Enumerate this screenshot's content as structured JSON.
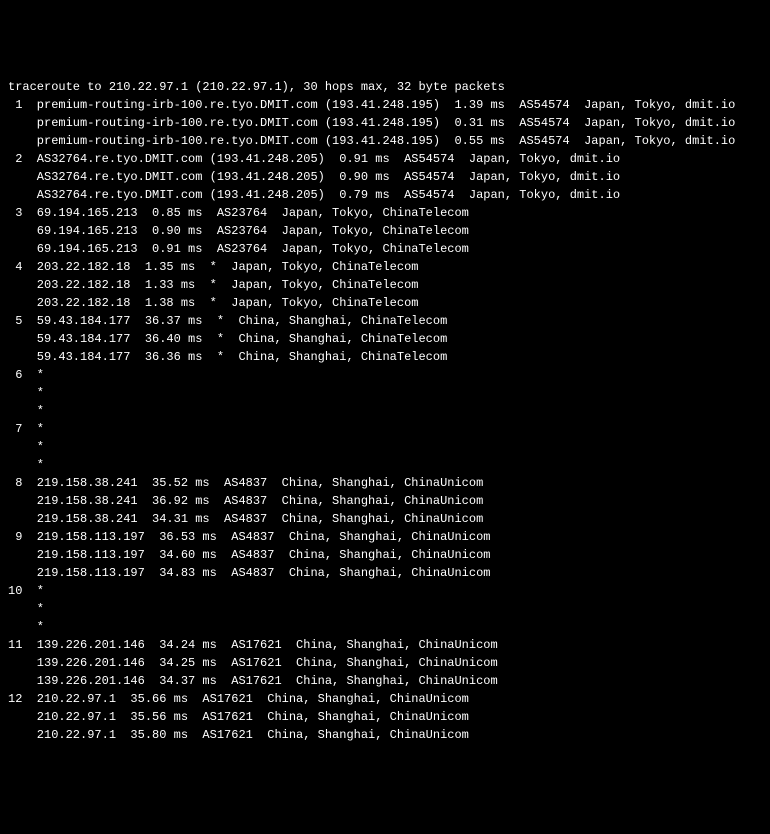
{
  "header": "traceroute to 210.22.97.1 (210.22.97.1), 30 hops max, 32 byte packets",
  "hops": [
    {
      "n": "1",
      "lines": [
        "premium-routing-irb-100.re.tyo.DMIT.com (193.41.248.195)  1.39 ms  AS54574  Japan, Tokyo, dmit.io",
        "premium-routing-irb-100.re.tyo.DMIT.com (193.41.248.195)  0.31 ms  AS54574  Japan, Tokyo, dmit.io",
        "premium-routing-irb-100.re.tyo.DMIT.com (193.41.248.195)  0.55 ms  AS54574  Japan, Tokyo, dmit.io"
      ]
    },
    {
      "n": "2",
      "lines": [
        "AS32764.re.tyo.DMIT.com (193.41.248.205)  0.91 ms  AS54574  Japan, Tokyo, dmit.io",
        "AS32764.re.tyo.DMIT.com (193.41.248.205)  0.90 ms  AS54574  Japan, Tokyo, dmit.io",
        "AS32764.re.tyo.DMIT.com (193.41.248.205)  0.79 ms  AS54574  Japan, Tokyo, dmit.io"
      ]
    },
    {
      "n": "3",
      "lines": [
        "69.194.165.213  0.85 ms  AS23764  Japan, Tokyo, ChinaTelecom",
        "69.194.165.213  0.90 ms  AS23764  Japan, Tokyo, ChinaTelecom",
        "69.194.165.213  0.91 ms  AS23764  Japan, Tokyo, ChinaTelecom"
      ]
    },
    {
      "n": "4",
      "lines": [
        "203.22.182.18  1.35 ms  *  Japan, Tokyo, ChinaTelecom",
        "203.22.182.18  1.33 ms  *  Japan, Tokyo, ChinaTelecom",
        "203.22.182.18  1.38 ms  *  Japan, Tokyo, ChinaTelecom"
      ]
    },
    {
      "n": "5",
      "lines": [
        "59.43.184.177  36.37 ms  *  China, Shanghai, ChinaTelecom",
        "59.43.184.177  36.40 ms  *  China, Shanghai, ChinaTelecom",
        "59.43.184.177  36.36 ms  *  China, Shanghai, ChinaTelecom"
      ]
    },
    {
      "n": "6",
      "lines": [
        "*",
        "*",
        "*"
      ]
    },
    {
      "n": "7",
      "lines": [
        "*",
        "*",
        "*"
      ]
    },
    {
      "n": "8",
      "lines": [
        "219.158.38.241  35.52 ms  AS4837  China, Shanghai, ChinaUnicom",
        "219.158.38.241  36.92 ms  AS4837  China, Shanghai, ChinaUnicom",
        "219.158.38.241  34.31 ms  AS4837  China, Shanghai, ChinaUnicom"
      ]
    },
    {
      "n": "9",
      "lines": [
        "219.158.113.197  36.53 ms  AS4837  China, Shanghai, ChinaUnicom",
        "219.158.113.197  34.60 ms  AS4837  China, Shanghai, ChinaUnicom",
        "219.158.113.197  34.83 ms  AS4837  China, Shanghai, ChinaUnicom"
      ]
    },
    {
      "n": "10",
      "lines": [
        "*",
        "*",
        "*"
      ]
    },
    {
      "n": "11",
      "lines": [
        "139.226.201.146  34.24 ms  AS17621  China, Shanghai, ChinaUnicom",
        "139.226.201.146  34.25 ms  AS17621  China, Shanghai, ChinaUnicom",
        "139.226.201.146  34.37 ms  AS17621  China, Shanghai, ChinaUnicom"
      ]
    },
    {
      "n": "12",
      "lines": [
        "210.22.97.1  35.66 ms  AS17621  China, Shanghai, ChinaUnicom",
        "210.22.97.1  35.56 ms  AS17621  China, Shanghai, ChinaUnicom",
        "210.22.97.1  35.80 ms  AS17621  China, Shanghai, ChinaUnicom"
      ]
    }
  ]
}
